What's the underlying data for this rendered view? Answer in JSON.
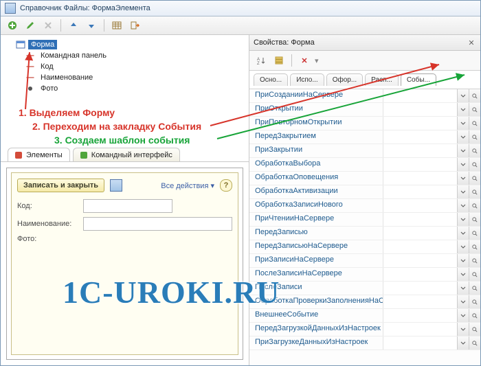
{
  "window": {
    "title": "Справочник Файлы: ФормаЭлемента"
  },
  "tree": {
    "root": "Форма",
    "children": [
      {
        "label": "Командная панель"
      },
      {
        "label": "Код"
      },
      {
        "label": "Наименование"
      },
      {
        "label": "Фото"
      }
    ]
  },
  "annotations": {
    "l1": "1. Выделяем Форму",
    "l2": "2. Переходим на закладку События",
    "l3": "3. Создаем шаблон события"
  },
  "left_tabs": {
    "t1": "Элементы",
    "t2": "Командный интерфейс"
  },
  "preview": {
    "save_close": "Записать и закрыть",
    "all_actions": "Все действия",
    "kod_label": "Код:",
    "name_label": "Наименование:",
    "photo_label": "Фото:",
    "kod_value": "",
    "name_value": ""
  },
  "prop_panel": {
    "title": "Свойства: Форма",
    "clear_symbol": "✕",
    "tabs": [
      "Осно...",
      "Испо...",
      "Офор...",
      "Расп...",
      "Собы..."
    ],
    "events": [
      "ПриСозданииНаСервере",
      "ПриОткрытии",
      "ПриПовторномОткрытии",
      "ПередЗакрытием",
      "ПриЗакрытии",
      "ОбработкаВыбора",
      "ОбработкаОповещения",
      "ОбработкаАктивизации",
      "ОбработкаЗаписиНового",
      "ПриЧтенииНаСервере",
      "ПередЗаписью",
      "ПередЗаписьюНаСервере",
      "ПриЗаписиНаСервере",
      "ПослеЗаписиНаСервере",
      "ПослеЗаписи",
      "ОбработкаПроверкиЗаполненияНаСервере",
      "ВнешнееСобытие",
      "ПередЗагрузкойДанныхИзНастроек",
      "ПриЗагрузкеДанныхИзНастроек"
    ]
  },
  "watermark": "1C-UROKI.RU"
}
